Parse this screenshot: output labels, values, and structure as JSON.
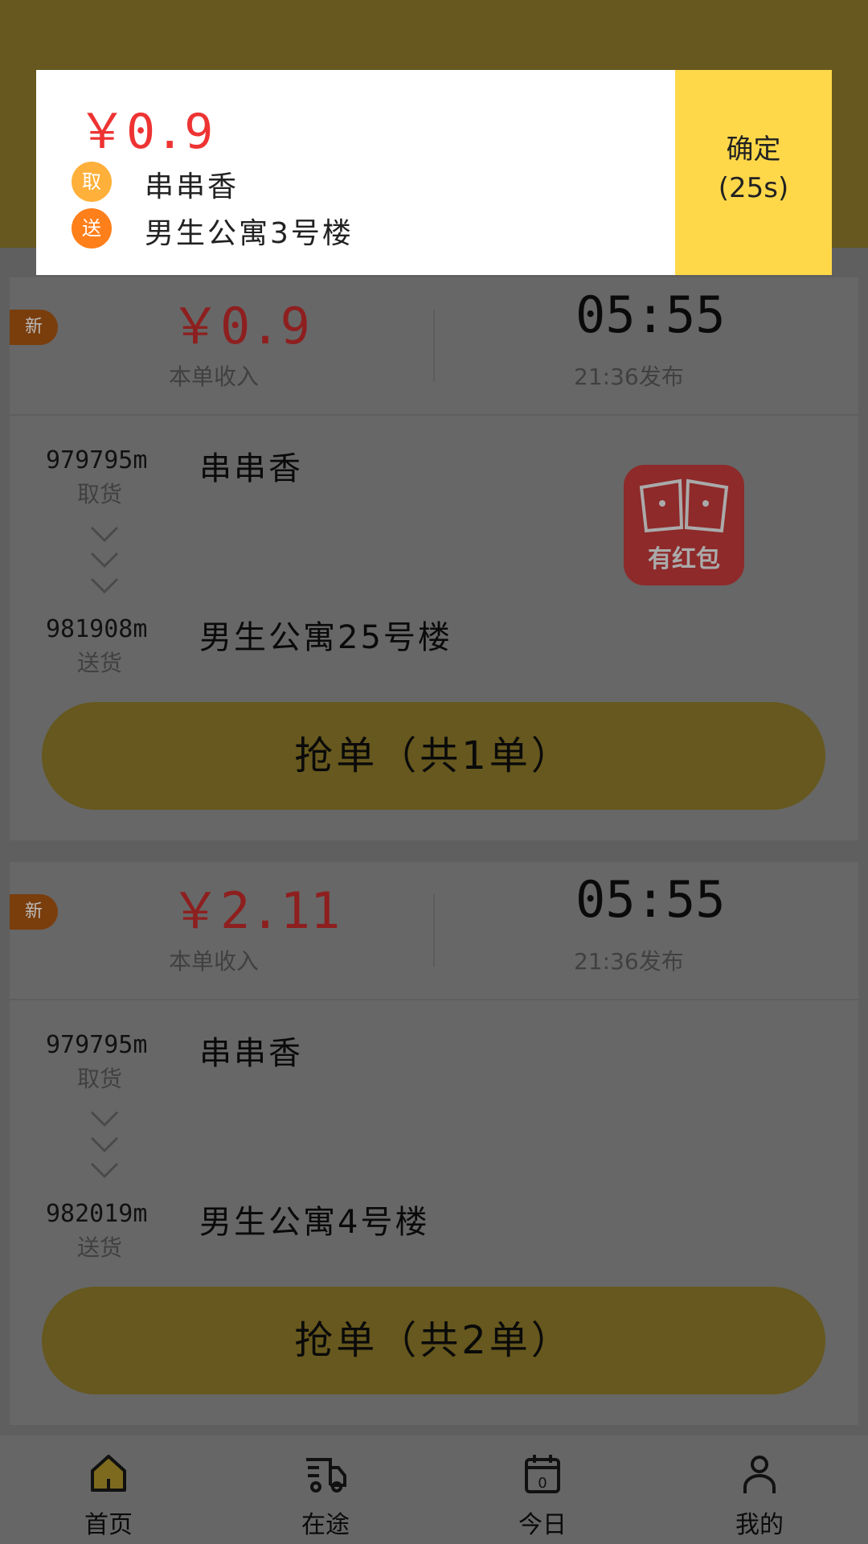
{
  "orders": [
    {
      "badge": "新",
      "price": "￥0.9",
      "price_label": "本单收入",
      "countdown": "05:55",
      "published": "21:36发布",
      "pickup_distance": "979795m",
      "pickup_label": "取货",
      "pickup_name": "串串香",
      "delivery_distance": "981908m",
      "delivery_label": "送货",
      "delivery_name": "男生公寓25号楼",
      "red_packet": "有红包",
      "grab_label": "抢单（共1单）"
    },
    {
      "badge": "新",
      "price": "￥2.11",
      "price_label": "本单收入",
      "countdown": "05:55",
      "published": "21:36发布",
      "pickup_distance": "979795m",
      "pickup_label": "取货",
      "pickup_name": "串串香",
      "delivery_distance": "982019m",
      "delivery_label": "送货",
      "delivery_name": "男生公寓4号楼",
      "grab_label": "抢单（共2单）"
    }
  ],
  "nav": [
    {
      "label": "首页",
      "icon": "home-icon",
      "active": true
    },
    {
      "label": "在途",
      "icon": "truck-icon"
    },
    {
      "label": "今日",
      "icon": "calendar-icon",
      "calendar_number": "0"
    },
    {
      "label": "我的",
      "icon": "user-icon"
    }
  ],
  "modal": {
    "price": "￥0.9",
    "pickup_tag": "取",
    "pickup_name": "串串香",
    "delivery_tag": "送",
    "delivery_name": "男生公寓3号楼",
    "confirm_label": "确定",
    "countdown": "(25s)"
  },
  "colors": {
    "accent": "#ffd84a",
    "price": "#e33333",
    "pickup_tag": "#ffb03a",
    "delivery_tag": "#ff7f1a"
  }
}
